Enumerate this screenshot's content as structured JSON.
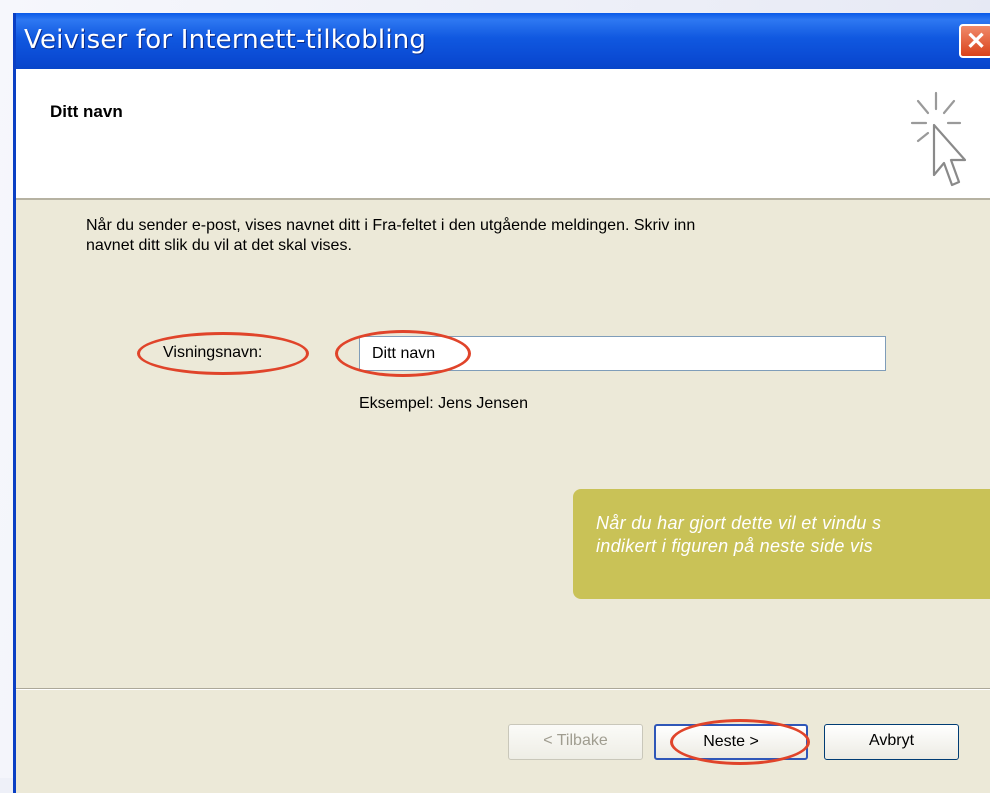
{
  "window": {
    "title": "Veiviser for Internett-tilkobling",
    "close_symbol": "✕"
  },
  "header": {
    "title": "Ditt navn",
    "icon": "wizard-cursor-icon"
  },
  "content": {
    "description_line1": "Når du sender e-post, vises navnet ditt i Fra-feltet i den utgående meldingen. Skriv inn",
    "description_line2": "navnet ditt slik du vil at det skal vises.",
    "field_label": "Visningsnavn:",
    "field_value": "Ditt navn",
    "example": "Eksempel: Jens Jensen"
  },
  "callout": {
    "line1": "Når du har gjort dette vil et vindu s",
    "line2": "indikert i figuren på neste side vis"
  },
  "buttons": {
    "back": "< Tilbake",
    "next": "Neste >",
    "cancel": "Avbryt"
  },
  "colors": {
    "titlebar": "#0a49d2",
    "highlight_ring": "#e0442a",
    "callout_bg": "#c9c257",
    "dialog_bg": "#ece9d8"
  }
}
